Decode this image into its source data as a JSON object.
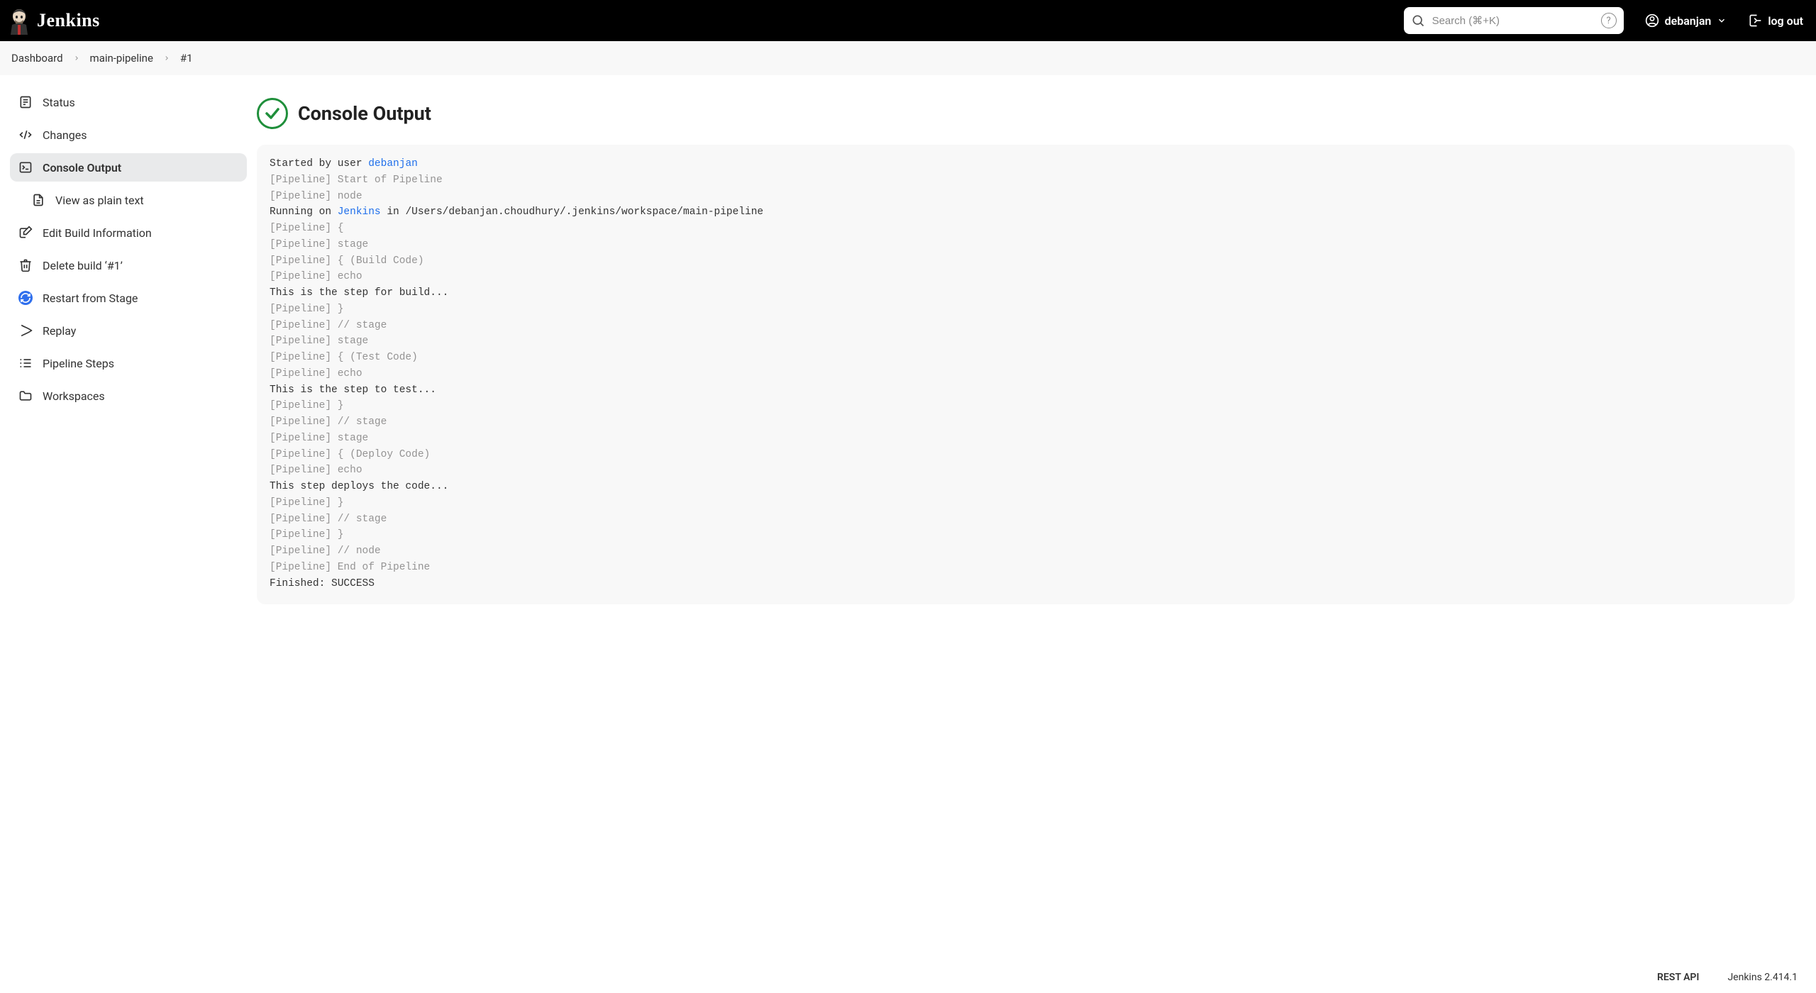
{
  "header": {
    "brand_name": "Jenkins",
    "search_placeholder": "Search (⌘+K)",
    "username": "debanjan",
    "logout_label": "log out"
  },
  "breadcrumbs": [
    "Dashboard",
    "main-pipeline",
    "#1"
  ],
  "sidebar": {
    "items": [
      {
        "id": "status",
        "label": "Status",
        "selected": false,
        "sub": false
      },
      {
        "id": "changes",
        "label": "Changes",
        "selected": false,
        "sub": false
      },
      {
        "id": "console",
        "label": "Console Output",
        "selected": true,
        "sub": false
      },
      {
        "id": "plaintext",
        "label": "View as plain text",
        "selected": false,
        "sub": true
      },
      {
        "id": "editbuild",
        "label": "Edit Build Information",
        "selected": false,
        "sub": false
      },
      {
        "id": "deletebuild",
        "label": "Delete build ‘#1’",
        "selected": false,
        "sub": false
      },
      {
        "id": "restartstage",
        "label": "Restart from Stage",
        "selected": false,
        "sub": false
      },
      {
        "id": "replay",
        "label": "Replay",
        "selected": false,
        "sub": false
      },
      {
        "id": "pipelinesteps",
        "label": "Pipeline Steps",
        "selected": false,
        "sub": false
      },
      {
        "id": "workspaces",
        "label": "Workspaces",
        "selected": false,
        "sub": false
      }
    ]
  },
  "page": {
    "title": "Console Output",
    "status": "success"
  },
  "console": {
    "user_link": "debanjan",
    "node_link": "Jenkins",
    "workspace_path": "/Users/debanjan.choudhury/.jenkins/workspace/main-pipeline",
    "lines": [
      {
        "segments": [
          {
            "t": "Started by user ",
            "c": "text"
          },
          {
            "t": "debanjan",
            "c": "link"
          }
        ]
      },
      {
        "segments": [
          {
            "t": "[Pipeline] Start of Pipeline",
            "c": "muted"
          }
        ]
      },
      {
        "segments": [
          {
            "t": "[Pipeline] node",
            "c": "muted"
          }
        ]
      },
      {
        "segments": [
          {
            "t": "Running on ",
            "c": "text"
          },
          {
            "t": "Jenkins",
            "c": "link"
          },
          {
            "t": " in /Users/debanjan.choudhury/.jenkins/workspace/main-pipeline",
            "c": "text"
          }
        ]
      },
      {
        "segments": [
          {
            "t": "[Pipeline] {",
            "c": "muted"
          }
        ]
      },
      {
        "segments": [
          {
            "t": "[Pipeline] stage",
            "c": "muted"
          }
        ]
      },
      {
        "segments": [
          {
            "t": "[Pipeline] { (Build Code)",
            "c": "muted"
          }
        ]
      },
      {
        "segments": [
          {
            "t": "[Pipeline] echo",
            "c": "muted"
          }
        ]
      },
      {
        "segments": [
          {
            "t": "This is the step for build...",
            "c": "text"
          }
        ]
      },
      {
        "segments": [
          {
            "t": "[Pipeline] }",
            "c": "muted"
          }
        ]
      },
      {
        "segments": [
          {
            "t": "[Pipeline] // stage",
            "c": "muted"
          }
        ]
      },
      {
        "segments": [
          {
            "t": "[Pipeline] stage",
            "c": "muted"
          }
        ]
      },
      {
        "segments": [
          {
            "t": "[Pipeline] { (Test Code)",
            "c": "muted"
          }
        ]
      },
      {
        "segments": [
          {
            "t": "[Pipeline] echo",
            "c": "muted"
          }
        ]
      },
      {
        "segments": [
          {
            "t": "This is the step to test...",
            "c": "text"
          }
        ]
      },
      {
        "segments": [
          {
            "t": "[Pipeline] }",
            "c": "muted"
          }
        ]
      },
      {
        "segments": [
          {
            "t": "[Pipeline] // stage",
            "c": "muted"
          }
        ]
      },
      {
        "segments": [
          {
            "t": "[Pipeline] stage",
            "c": "muted"
          }
        ]
      },
      {
        "segments": [
          {
            "t": "[Pipeline] { (Deploy Code)",
            "c": "muted"
          }
        ]
      },
      {
        "segments": [
          {
            "t": "[Pipeline] echo",
            "c": "muted"
          }
        ]
      },
      {
        "segments": [
          {
            "t": "This step deploys the code...",
            "c": "text"
          }
        ]
      },
      {
        "segments": [
          {
            "t": "[Pipeline] }",
            "c": "muted"
          }
        ]
      },
      {
        "segments": [
          {
            "t": "[Pipeline] // stage",
            "c": "muted"
          }
        ]
      },
      {
        "segments": [
          {
            "t": "[Pipeline] }",
            "c": "muted"
          }
        ]
      },
      {
        "segments": [
          {
            "t": "[Pipeline] // node",
            "c": "muted"
          }
        ]
      },
      {
        "segments": [
          {
            "t": "[Pipeline] End of Pipeline",
            "c": "muted"
          }
        ]
      },
      {
        "segments": [
          {
            "t": "Finished: SUCCESS",
            "c": "text"
          }
        ]
      }
    ]
  },
  "footer": {
    "rest_api_label": "REST API",
    "version_label": "Jenkins 2.414.1"
  }
}
